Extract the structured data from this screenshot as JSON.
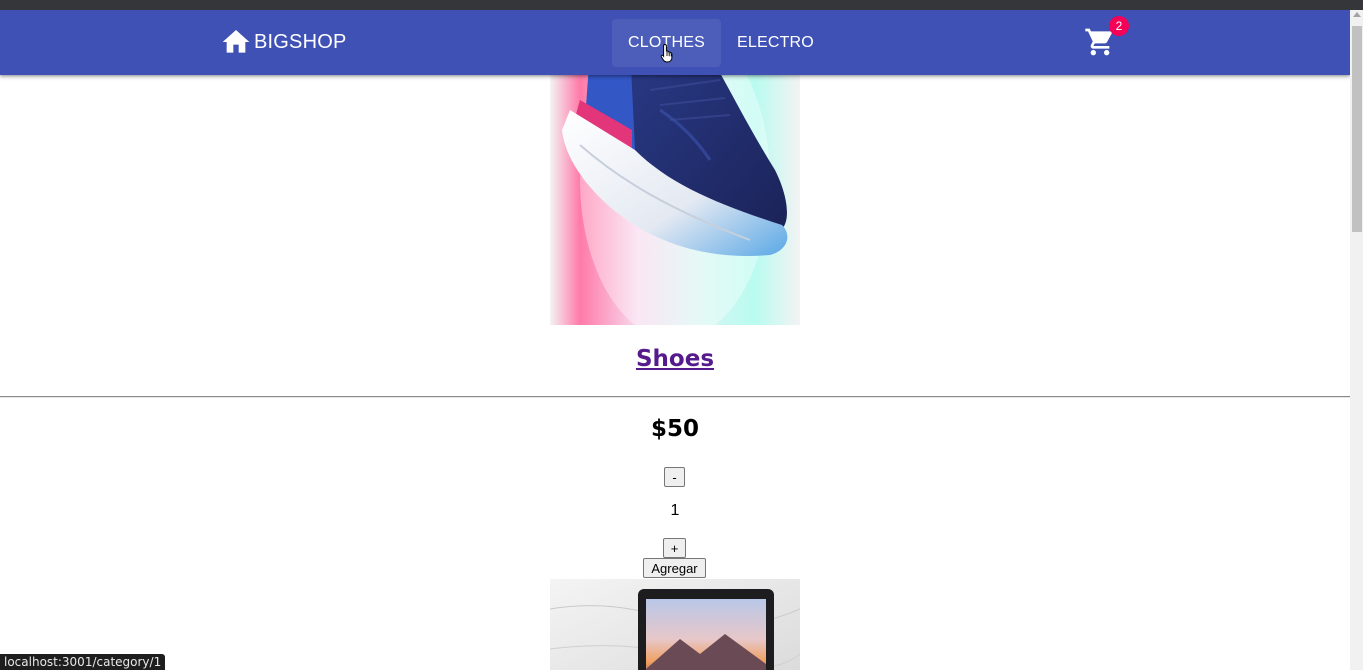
{
  "appbar": {
    "brand_label": "BIGSHOP",
    "nav": [
      {
        "label": "CLOTHES"
      },
      {
        "label": "ELECTRO"
      }
    ],
    "cart_count": "2",
    "colors": {
      "bar": "#3f51b5",
      "badge": "#f50057"
    }
  },
  "product": {
    "name": "Shoes",
    "price": "$50",
    "decrement_label": "-",
    "quantity": "1",
    "increment_label": "+",
    "add_label": "Agregar"
  },
  "status": {
    "url": "localhost:3001/category/1"
  }
}
